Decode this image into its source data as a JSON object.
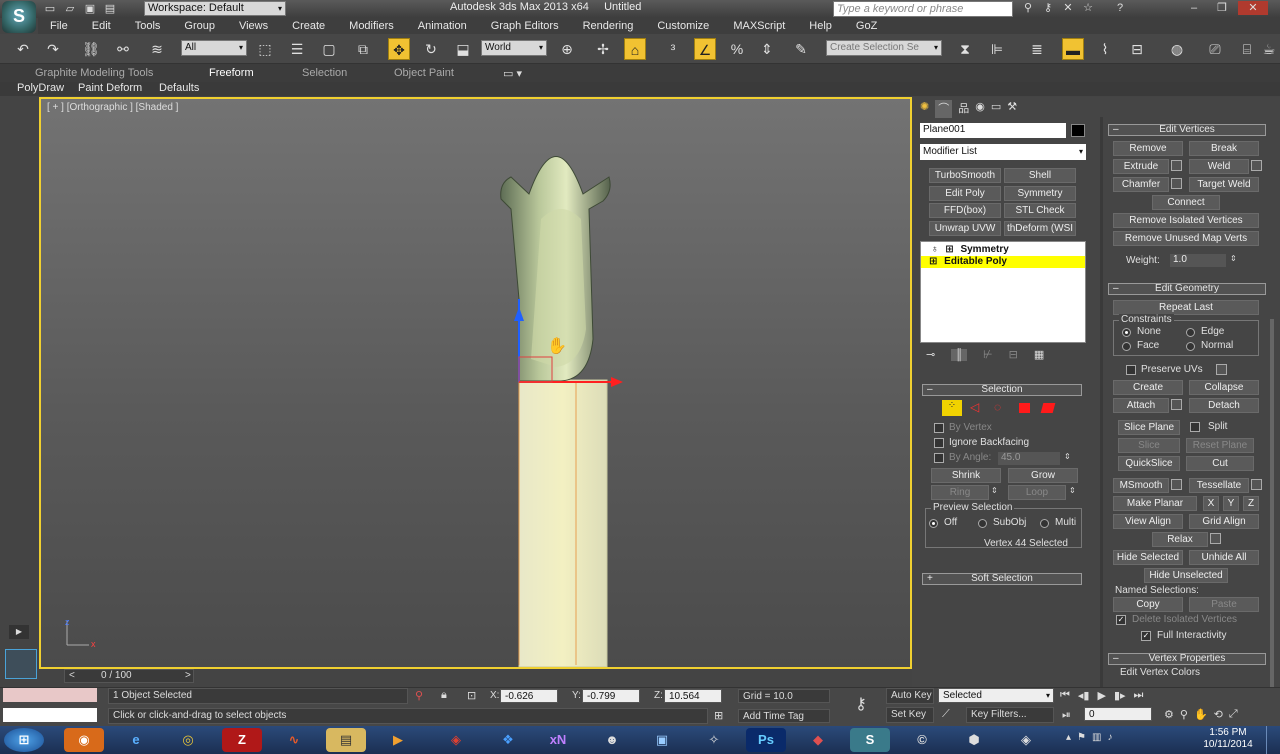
{
  "titlebar": {
    "workspace": "Workspace: Default",
    "app_title": "Autodesk 3ds Max  2013 x64",
    "doc_title": "Untitled",
    "search_placeholder": "Type a keyword or phrase"
  },
  "menubar": [
    "File",
    "Edit",
    "Tools",
    "Group",
    "Views",
    "Create",
    "Modifiers",
    "Animation",
    "Graph Editors",
    "Rendering",
    "Customize",
    "MAXScript",
    "Help",
    "GoZ"
  ],
  "toolbar": {
    "selection_filter": "All",
    "coord_system": "World",
    "named_selection_placeholder": "Create Selection Se"
  },
  "ribbon": {
    "tabs": [
      "Graphite Modeling Tools",
      "Freeform",
      "Selection",
      "Object Paint"
    ],
    "active_tab": "Freeform",
    "subtabs": [
      "PolyDraw",
      "Paint Deform",
      "Defaults"
    ]
  },
  "viewport": {
    "label": "[ + ] [Orthographic ] [Shaded ]",
    "timeline": "0 / 100",
    "axis_z": "z",
    "axis_x": "x"
  },
  "modify_panel": {
    "object_name": "Plane001",
    "modifier_list": "Modifier List",
    "modifier_buttons": [
      "TurboSmooth",
      "Shell",
      "Edit Poly",
      "Symmetry",
      "FFD(box)",
      "STL Check",
      "Unwrap UVW",
      "thDeform (WSI"
    ],
    "stack": [
      "Symmetry",
      "Editable Poly"
    ]
  },
  "selection_rollout": {
    "title": "Selection",
    "by_vertex": "By Vertex",
    "ignore_backfacing": "Ignore Backfacing",
    "by_angle": "By Angle:",
    "by_angle_value": "45.0",
    "shrink": "Shrink",
    "grow": "Grow",
    "ring": "Ring",
    "loop": "Loop",
    "preview_selection": "Preview Selection",
    "off": "Off",
    "subobj": "SubObj",
    "multi": "Multi",
    "status": "Vertex 44 Selected",
    "soft_selection": "Soft Selection"
  },
  "edit_vertices": {
    "title": "Edit Vertices",
    "buttons": [
      "Remove",
      "Break",
      "Extrude",
      "Weld",
      "Chamfer",
      "Target Weld",
      "Connect",
      "Remove Isolated Vertices",
      "Remove Unused Map Verts"
    ],
    "weight_label": "Weight:",
    "weight_value": "1.0"
  },
  "edit_geometry": {
    "title": "Edit Geometry",
    "repeat_last": "Repeat Last",
    "constraints": "Constraints",
    "none": "None",
    "edge": "Edge",
    "face": "Face",
    "normal": "Normal",
    "preserve_uvs": "Preserve UVs",
    "create": "Create",
    "collapse": "Collapse",
    "attach": "Attach",
    "detach": "Detach",
    "slice_plane": "Slice Plane",
    "split": "Split",
    "slice": "Slice",
    "reset_plane": "Reset Plane",
    "quickslice": "QuickSlice",
    "cut": "Cut",
    "msmooth": "MSmooth",
    "tessellate": "Tessellate",
    "make_planar": "Make Planar",
    "x": "X",
    "y": "Y",
    "z": "Z",
    "view_align": "View Align",
    "grid_align": "Grid Align",
    "relax": "Relax",
    "hide_selected": "Hide Selected",
    "unhide_all": "Unhide All",
    "hide_unselected": "Hide Unselected",
    "named_selections": "Named Selections:",
    "copy": "Copy",
    "paste": "Paste",
    "delete_isolated": "Delete Isolated Vertices",
    "full_interactivity": "Full Interactivity"
  },
  "vertex_properties": {
    "title": "Vertex Properties",
    "edit_vertex_colors": "Edit Vertex Colors"
  },
  "statusbar": {
    "selection": "1 Object Selected",
    "prompt": "Click or click-and-drag to select objects",
    "x_label": "X:",
    "x": "-0.626",
    "y_label": "Y:",
    "y": "-0.799",
    "z_label": "Z:",
    "z": "10.564",
    "grid": "Grid = 10.0",
    "add_time_tag": "Add Time Tag",
    "auto_key": "Auto Key",
    "set_key": "Set Key",
    "key_mode": "Selected",
    "key_filters": "Key Filters...",
    "frame": "0"
  },
  "taskbar": {
    "time": "1:56 PM",
    "date": "10/11/2014"
  },
  "colors": {
    "viewport_border": "#f0d030",
    "active_button": "#f1c232",
    "stack_highlight": "#ffff00"
  }
}
